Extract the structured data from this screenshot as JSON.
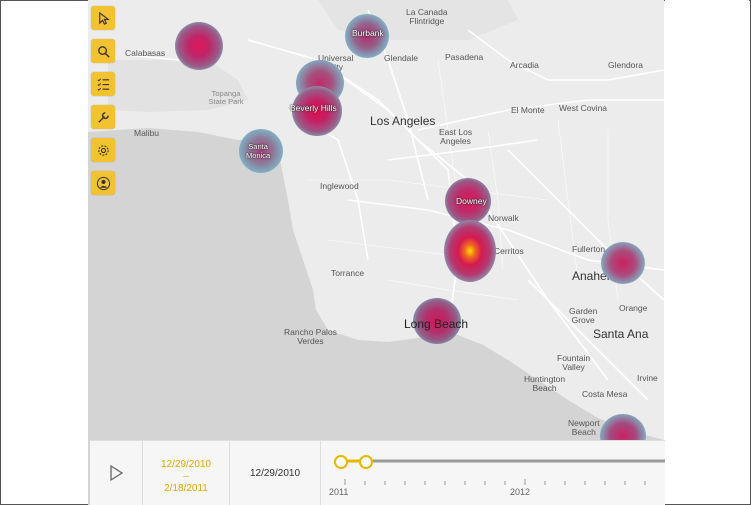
{
  "toolbar": {
    "tools": [
      {
        "name": "select-tool-button",
        "icon": "cursor-icon"
      },
      {
        "name": "search-tool-button",
        "icon": "search-icon"
      },
      {
        "name": "layers-list-button",
        "icon": "checklist-icon"
      },
      {
        "name": "tools-button",
        "icon": "wrench-icon"
      },
      {
        "name": "settings-button",
        "icon": "gear-icon"
      },
      {
        "name": "account-button",
        "icon": "user-icon"
      }
    ],
    "accent": "#f2c230"
  },
  "map": {
    "places": {
      "la_canada": "La Canada\nFlintridge",
      "calabasas": "Calabasas",
      "universal_city": "Universal\nCity",
      "glendale": "Glendale",
      "pasadena": "Pasadena",
      "arcadia": "Arcadia",
      "glendora": "Glendora",
      "topanga": "Topanga\nState Park",
      "malibu": "Malibu",
      "los_angeles": "Los Angeles",
      "el_monte": "El Monte",
      "west_covina": "West Covina",
      "east_la": "East Los\nAngeles",
      "inglewood": "Inglewood",
      "norwalk": "Norwalk",
      "cerritos": "Cerritos",
      "fullerton": "Fullerton",
      "anaheim": "Anaheim",
      "torrance": "Torrance",
      "orange": "Orange",
      "garden_grove": "Garden\nGrove",
      "santa_ana": "Santa Ana",
      "rancho_palos_verdes": "Rancho Palos\nVerdes",
      "long_beach": "Long Beach",
      "fountain_valley": "Fountain\nValley",
      "huntington_beach": "Huntington\nBeach",
      "irvine": "Irvine",
      "costa_mesa": "Costa Mesa",
      "newport_beach": "Newport\nBeach"
    },
    "hotspot_labels": {
      "burbank": "Burbank",
      "beverly_hills": "Beverly Hills",
      "santa_monica": "Santa\nMonica",
      "downey": "Downey"
    },
    "heat_colors": {
      "edge": "#7fb3c6",
      "mid": "#c9246a",
      "hot": "#ffd400"
    }
  },
  "timeline": {
    "range_start": "12/29/2010",
    "range_sep": "–",
    "range_end": "2/18/2011",
    "current_date": "12/29/2010",
    "years": [
      "2011",
      "2012"
    ],
    "accent": "#e6b800"
  }
}
